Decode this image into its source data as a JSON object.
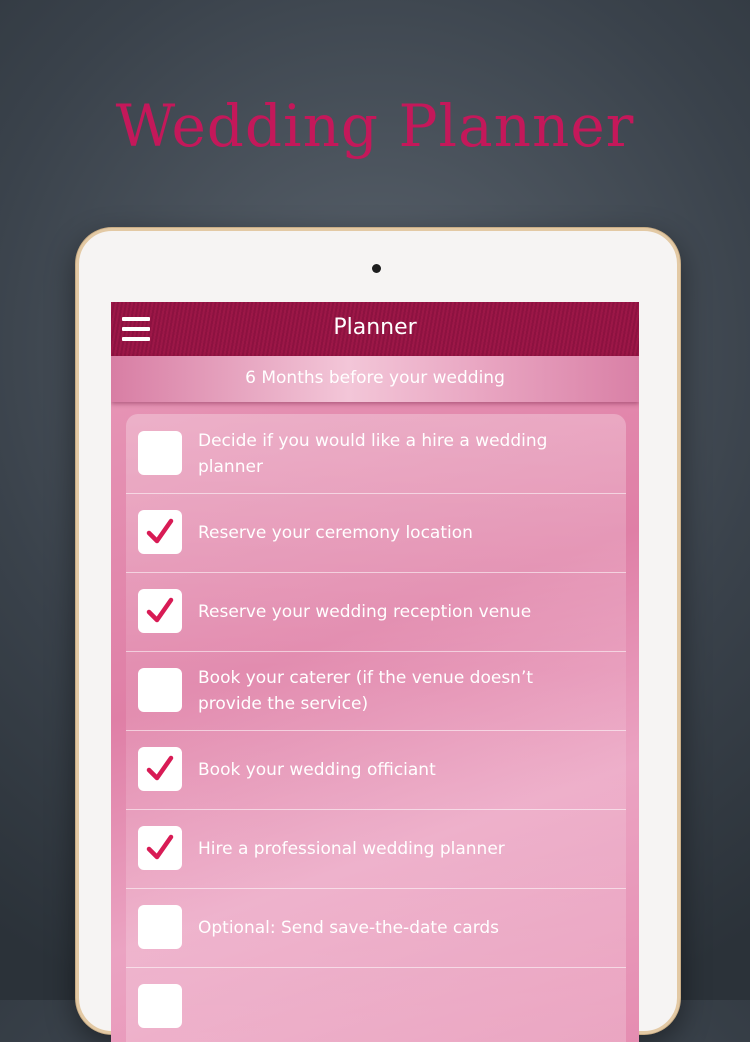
{
  "promo": {
    "title": "Wedding Planner"
  },
  "navbar": {
    "title": "Planner",
    "menu_icon": "hamburger-menu-icon"
  },
  "section": {
    "title": "6 Months before your wedding"
  },
  "colors": {
    "accent": "#c4185a",
    "navbar": "#9c1747",
    "check": "#d81b55"
  },
  "tasks": [
    {
      "label": "Decide if you would like a hire a wedding planner",
      "checked": false
    },
    {
      "label": "Reserve your ceremony location",
      "checked": true
    },
    {
      "label": "Reserve your wedding reception venue",
      "checked": true
    },
    {
      "label": "Book your caterer (if the venue doesn’t provide the service)",
      "checked": false
    },
    {
      "label": "Book your wedding officiant",
      "checked": true
    },
    {
      "label": "Hire a professional wedding planner",
      "checked": true
    },
    {
      "label": "Optional: Send save-the-date cards",
      "checked": false
    },
    {
      "label": "",
      "checked": false
    }
  ]
}
